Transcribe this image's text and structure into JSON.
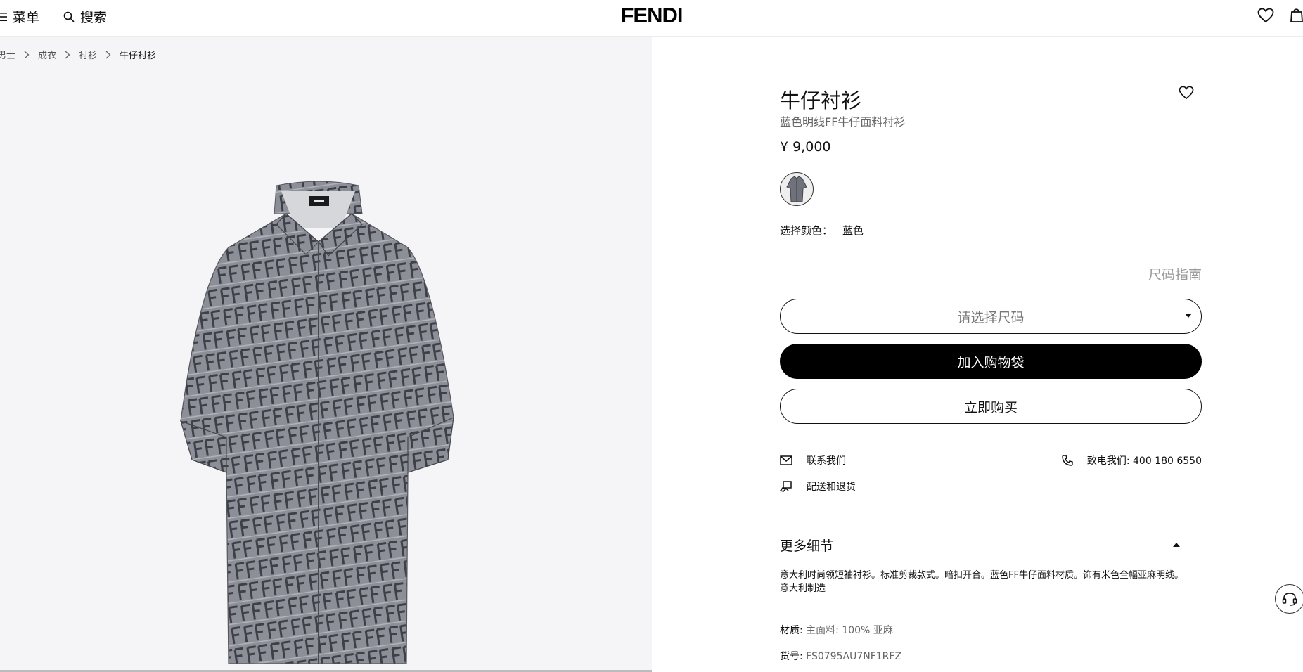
{
  "header": {
    "menu_label": "菜单",
    "search_label": "搜索",
    "logo": "FENDI",
    "icons": [
      "menu-icon",
      "search-icon",
      "heart-icon",
      "shopping-bag-icon"
    ]
  },
  "breadcrumb": [
    "男士",
    "成衣",
    "衬衫",
    "牛仔衬衫"
  ],
  "product": {
    "title": "牛仔衬衫",
    "subtitle": "蓝色明线FF牛仔面料衬衫",
    "price": "¥ 9,000",
    "color_label": "选择颜色：",
    "color_value": "蓝色",
    "size_guide": "尺码指南",
    "size_placeholder": "请选择尺码",
    "add_to_bag": "加入购物袋",
    "buy_now": "立即购买"
  },
  "services": {
    "contact": "联系我们",
    "delivery": "配送和退货",
    "phone": "致电我们: 400 180 6550"
  },
  "details": {
    "heading": "更多细节",
    "description_line1": "意大利时尚领短袖衬衫。标准剪裁款式。暗扣开合。蓝色FF牛仔面料材质。饰有米色全幅亚麻明线。",
    "description_line2": "意大利制造",
    "material_label": "材质:",
    "material_value": "主面料: 100% 亚麻",
    "sku_label": "货号:",
    "sku_value": "FS0795AU7NF1RFZ"
  },
  "colors": {
    "accent": "#000000",
    "panel_bg": "#f5f5f7",
    "muted_text": "#666666"
  }
}
